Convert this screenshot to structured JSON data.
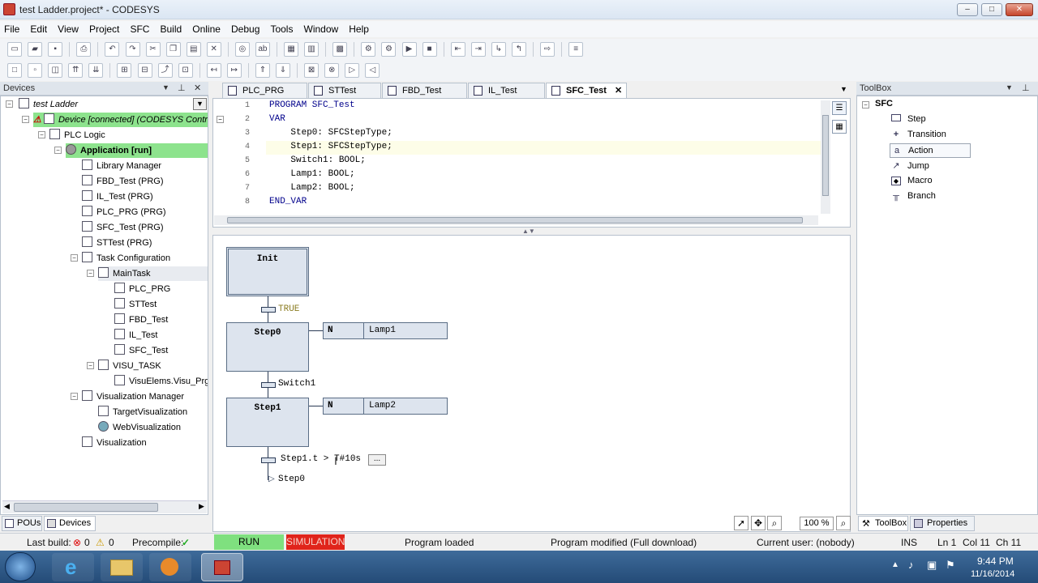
{
  "window": {
    "title": "test Ladder.project* - CODESYS",
    "min": "–",
    "max": "□",
    "close": "✕"
  },
  "menu": [
    "File",
    "Edit",
    "View",
    "Project",
    "SFC",
    "Build",
    "Online",
    "Debug",
    "Tools",
    "Window",
    "Help"
  ],
  "devices_panel": {
    "title": "Devices",
    "pin": "⊥",
    "close": "✕",
    "dropdown_value": "test Ladder",
    "items": [
      {
        "label": "Device [connected] (CODESYS Contr",
        "indent": 1
      },
      {
        "label": "PLC Logic",
        "indent": 2
      },
      {
        "label": "Application [run]",
        "indent": 3
      },
      {
        "label": "Library Manager",
        "indent": 4
      },
      {
        "label": "FBD_Test (PRG)",
        "indent": 4
      },
      {
        "label": "IL_Test (PRG)",
        "indent": 4
      },
      {
        "label": "PLC_PRG (PRG)",
        "indent": 4
      },
      {
        "label": "SFC_Test (PRG)",
        "indent": 4
      },
      {
        "label": "STTest (PRG)",
        "indent": 4
      },
      {
        "label": "Task Configuration",
        "indent": 4
      },
      {
        "label": "MainTask",
        "indent": 5
      },
      {
        "label": "PLC_PRG",
        "indent": 6
      },
      {
        "label": "STTest",
        "indent": 6
      },
      {
        "label": "FBD_Test",
        "indent": 6
      },
      {
        "label": "IL_Test",
        "indent": 6
      },
      {
        "label": "SFC_Test",
        "indent": 6
      },
      {
        "label": "VISU_TASK",
        "indent": 5
      },
      {
        "label": "VisuElems.Visu_Prg",
        "indent": 6
      },
      {
        "label": "Visualization Manager",
        "indent": 4
      },
      {
        "label": "TargetVisualization",
        "indent": 5
      },
      {
        "label": "WebVisualization",
        "indent": 5
      },
      {
        "label": "Visualization",
        "indent": 4
      }
    ],
    "bottom_tabs": [
      "POUs",
      "Devices"
    ]
  },
  "editor": {
    "tabs": [
      "PLC_PRG",
      "STTest",
      "FBD_Test",
      "IL_Test",
      "SFC_Test"
    ],
    "active_tab": "SFC_Test",
    "tab_close": "✕",
    "line_numbers": [
      "1",
      "2",
      "3",
      "4",
      "5",
      "6",
      "7",
      "8"
    ],
    "code_lines": [
      "PROGRAM SFC_Test",
      "VAR",
      "    Step0: SFCStepType;",
      "    Step1: SFCStepType;",
      "    Switch1: BOOL;",
      "    Lamp1: BOOL;",
      "    Lamp2: BOOL;",
      "END_VAR"
    ],
    "sfc": {
      "init_step": "Init",
      "t0": "TRUE",
      "step0": "Step0",
      "step0_qualifier": "N",
      "step0_action": "Lamp1",
      "t1": "Switch1",
      "step1": "Step1",
      "step1_qualifier": "N",
      "step1_action": "Lamp2",
      "t2": "Step1.t > T#10s",
      "t2_button": "...",
      "jump": "Step0"
    },
    "zoom": "100 %"
  },
  "toolbox": {
    "title": "ToolBox",
    "category": "SFC",
    "items": [
      "Step",
      "Transition",
      "Action",
      "Jump",
      "Macro",
      "Branch"
    ],
    "selected": "Action",
    "bottom_tabs": [
      "ToolBox",
      "Properties"
    ]
  },
  "status": {
    "last_build_label": "Last build:",
    "errors": "0",
    "warnings": "0",
    "precompile_label": "Precompile:",
    "run": "RUN",
    "simulation": "SIMULATION",
    "program_state": "Program loaded",
    "modified": "Program modified (Full download)",
    "user": "Current user: (nobody)",
    "ins": "INS",
    "ln": "Ln 1",
    "col": "Col 11",
    "ch": "Ch 11"
  },
  "taskbar": {
    "time": "9:44 PM",
    "date": "11/16/2014"
  },
  "colors": {
    "run_green": "#7fe07f",
    "sim_red": "#e0241b",
    "app_green": "#8de38d",
    "title_blue": "#dbe6f3"
  }
}
